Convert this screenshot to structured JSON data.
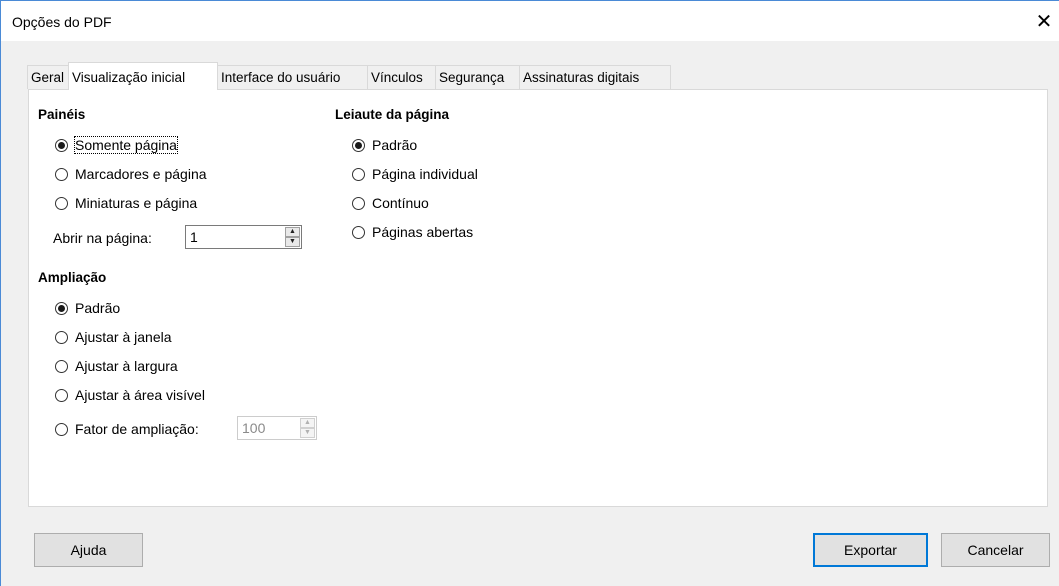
{
  "window": {
    "title": "Opções do PDF",
    "close_glyph": "✕"
  },
  "tabs": [
    {
      "label": "Geral",
      "active": false
    },
    {
      "label": "Visualização inicial",
      "active": true
    },
    {
      "label": "Interface do usuário",
      "active": false
    },
    {
      "label": "Vínculos",
      "active": false
    },
    {
      "label": "Segurança",
      "active": false
    },
    {
      "label": "Assinaturas digitais",
      "active": false
    }
  ],
  "paineis": {
    "heading": "Painéis",
    "options": [
      {
        "label": "Somente página",
        "checked": true
      },
      {
        "label": "Marcadores e página",
        "checked": false
      },
      {
        "label": "Miniaturas e página",
        "checked": false
      }
    ],
    "open_page_label": "Abrir na página:",
    "open_page_value": "1"
  },
  "ampliacao": {
    "heading": "Ampliação",
    "options": [
      {
        "label": "Padrão",
        "checked": true
      },
      {
        "label": "Ajustar à janela",
        "checked": false
      },
      {
        "label": "Ajustar à largura",
        "checked": false
      },
      {
        "label": "Ajustar à área visível",
        "checked": false
      },
      {
        "label": "Fator de ampliação:",
        "checked": false
      }
    ],
    "zoom_value": "100"
  },
  "leiaute": {
    "heading": "Leiaute da página",
    "options": [
      {
        "label": "Padrão",
        "checked": true
      },
      {
        "label": "Página individual",
        "checked": false
      },
      {
        "label": "Contínuo",
        "checked": false
      },
      {
        "label": "Páginas abertas",
        "checked": false
      }
    ]
  },
  "buttons": {
    "help": "Ajuda",
    "export": "Exportar",
    "cancel": "Cancelar"
  },
  "colors": {
    "accent": "#0078d7",
    "window_border": "#4a8ad6"
  }
}
